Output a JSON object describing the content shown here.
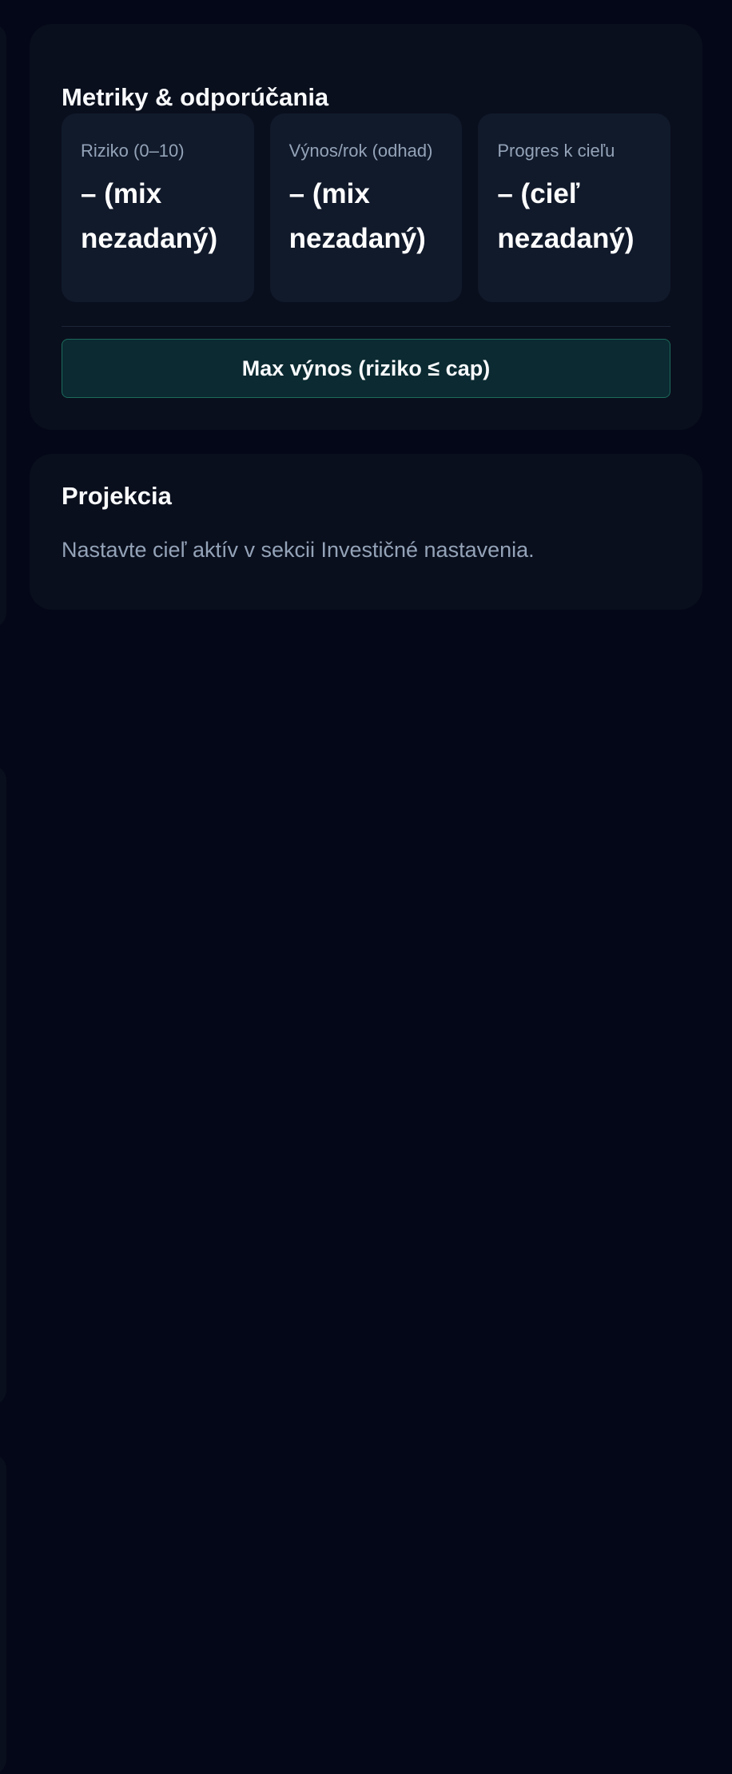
{
  "metrics": {
    "title": "Metriky & odporúčania",
    "cards": [
      {
        "label": "Riziko (0–10)",
        "value": "– (mix nezadaný)"
      },
      {
        "label": "Výnos/rok (odhad)",
        "value": "– (mix nezadaný)"
      },
      {
        "label": "Progres k cieľu",
        "value": "– (cieľ nezadaný)"
      }
    ],
    "action_label": "Max výnos (riziko ≤ cap)"
  },
  "projection": {
    "title": "Projekcia",
    "message": "Nastavte cieľ aktív v sekcii Investičné nastavenia."
  }
}
